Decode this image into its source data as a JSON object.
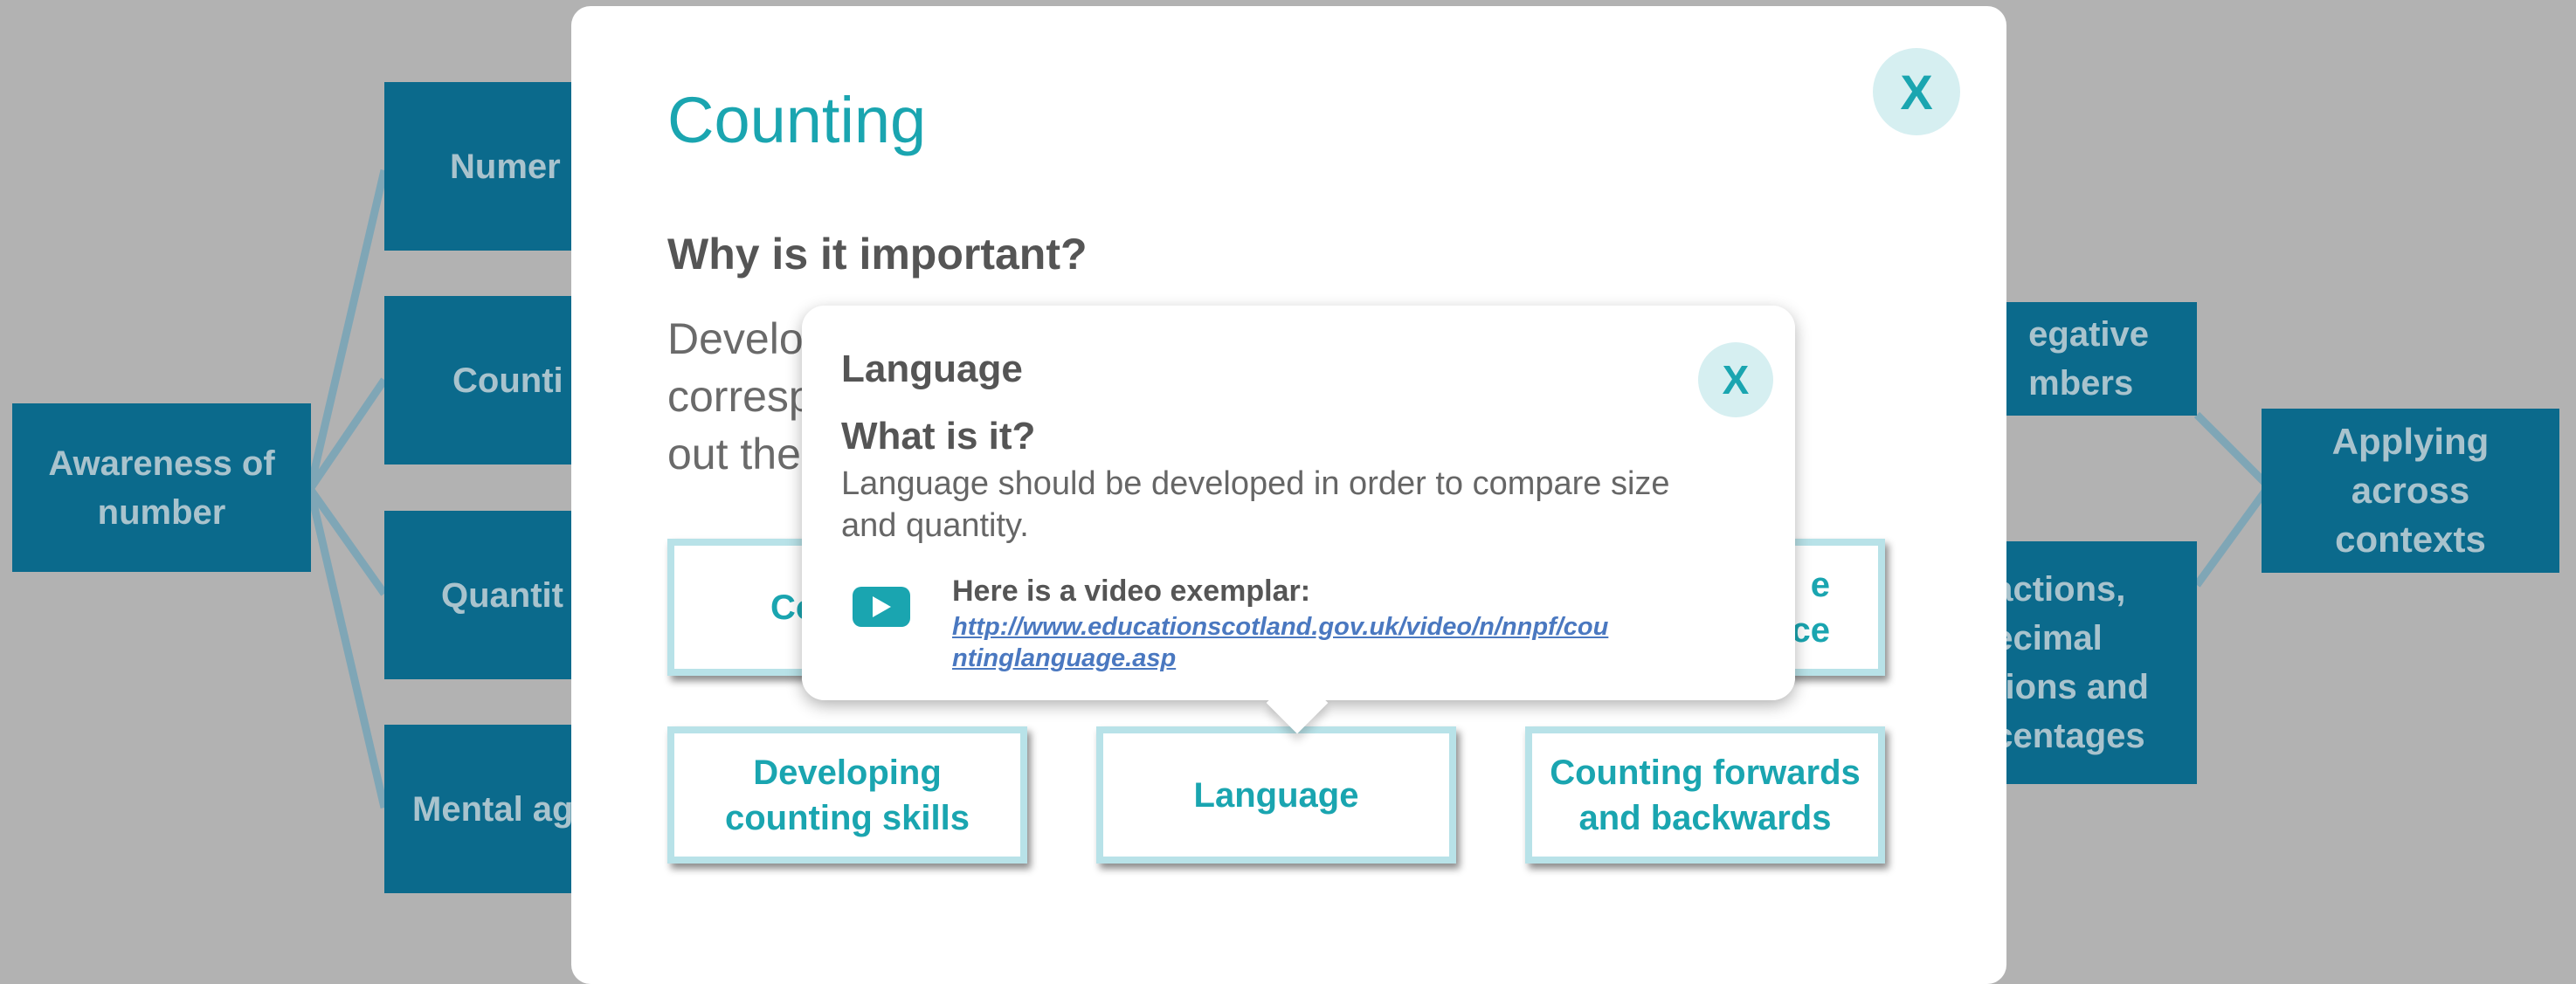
{
  "concept_map": {
    "root": "Awareness of number",
    "branches_left": [
      "Numer",
      "Counti",
      "Quantit",
      "Mental ag"
    ],
    "right_fragments": [
      "egative\nmbers",
      "actions,\necimal\ntions and\ncentages"
    ],
    "right_root": "Applying across contexts"
  },
  "modal": {
    "title": "Counting",
    "close_label": "X",
    "why_heading": "Why is it important?",
    "why_body": "Develo                                                                       one\ncorresp                                                                        y\nout the",
    "topics": [
      {
        "label": "Co"
      },
      {
        "label": ""
      },
      {
        "label": "e\nnce"
      },
      {
        "label": "Developing\ncounting skills"
      },
      {
        "label": "Language"
      },
      {
        "label": "Counting forwards\nand backwards"
      }
    ]
  },
  "popover": {
    "title": "Language",
    "close_label": "X",
    "question": "What is it?",
    "answer": "Language should be developed in order to compare size and quantity.",
    "video_icon": "play-icon",
    "video_label": "Here is a video exemplar:",
    "video_link": "http://www.educationscotland.gov.uk/video/n/nnpf/countinglanguage.asp"
  },
  "colors": {
    "overlay": "#b2b2b2",
    "node_bg": "#0b6a8c",
    "accent": "#1aa5b0",
    "close_bg": "#d6eff1"
  }
}
